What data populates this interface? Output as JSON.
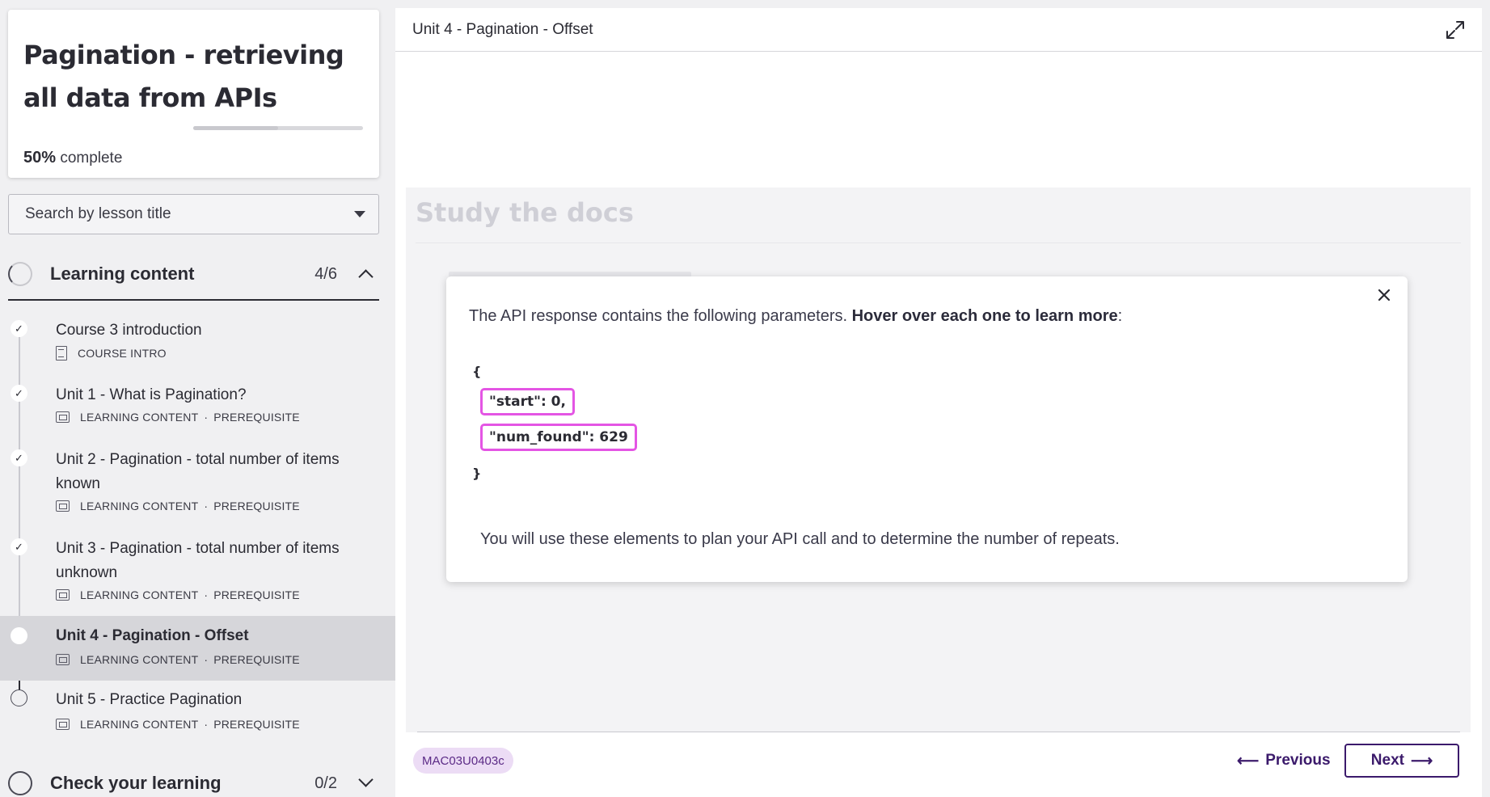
{
  "course": {
    "title": "Pagination - retrieving all data from APIs",
    "progress_percent": 50,
    "progress_value": "50%",
    "progress_suffix": "complete"
  },
  "search": {
    "placeholder": "Search by lesson title"
  },
  "sections": {
    "learning": {
      "title": "Learning content",
      "count": "4/6"
    },
    "check": {
      "title": "Check your learning",
      "count": "0/2"
    }
  },
  "lessons": [
    {
      "title": "Course 3 introduction",
      "meta": [
        "COURSE INTRO"
      ],
      "state": "done",
      "icon": "document-icon"
    },
    {
      "title": "Unit 1 - What is Pagination?",
      "meta": [
        "LEARNING CONTENT",
        "PREREQUISITE"
      ],
      "state": "done",
      "icon": "slides-icon"
    },
    {
      "title": "Unit 2 - Pagination - total number of items known",
      "meta": [
        "LEARNING CONTENT",
        "PREREQUISITE"
      ],
      "state": "done",
      "icon": "slides-icon"
    },
    {
      "title": "Unit 3 - Pagination - total number of items unknown",
      "meta": [
        "LEARNING CONTENT",
        "PREREQUISITE"
      ],
      "state": "done",
      "icon": "slides-icon"
    },
    {
      "title": "Unit 4 - Pagination - Offset",
      "meta": [
        "LEARNING CONTENT",
        "PREREQUISITE"
      ],
      "state": "current",
      "icon": "slides-icon"
    },
    {
      "title": "Unit 5 - Practice Pagination",
      "meta": [
        "LEARNING CONTENT",
        "PREREQUISITE"
      ],
      "state": "todo",
      "icon": "slides-icon"
    }
  ],
  "main": {
    "header_title": "Unit 4 - Pagination - Offset",
    "frame_heading": "Study the docs",
    "popup": {
      "intro_plain": "The API response contains the following parameters. ",
      "intro_bold": "Hover over each one to learn more",
      "intro_end": ":",
      "open_brace": "{",
      "params": [
        "\"start\": 0,",
        "\"num_found\": 629"
      ],
      "close_brace": "}",
      "footer_text": "You will use these elements to plan your API call and to determine the number of repeats."
    },
    "code_badge": "MAC03U0403c",
    "prev_label": "Previous",
    "next_label": "Next"
  },
  "colors": {
    "accent": "#3b1a6b",
    "highlight": "#e455e4",
    "badge_bg": "#ecdcf5"
  }
}
